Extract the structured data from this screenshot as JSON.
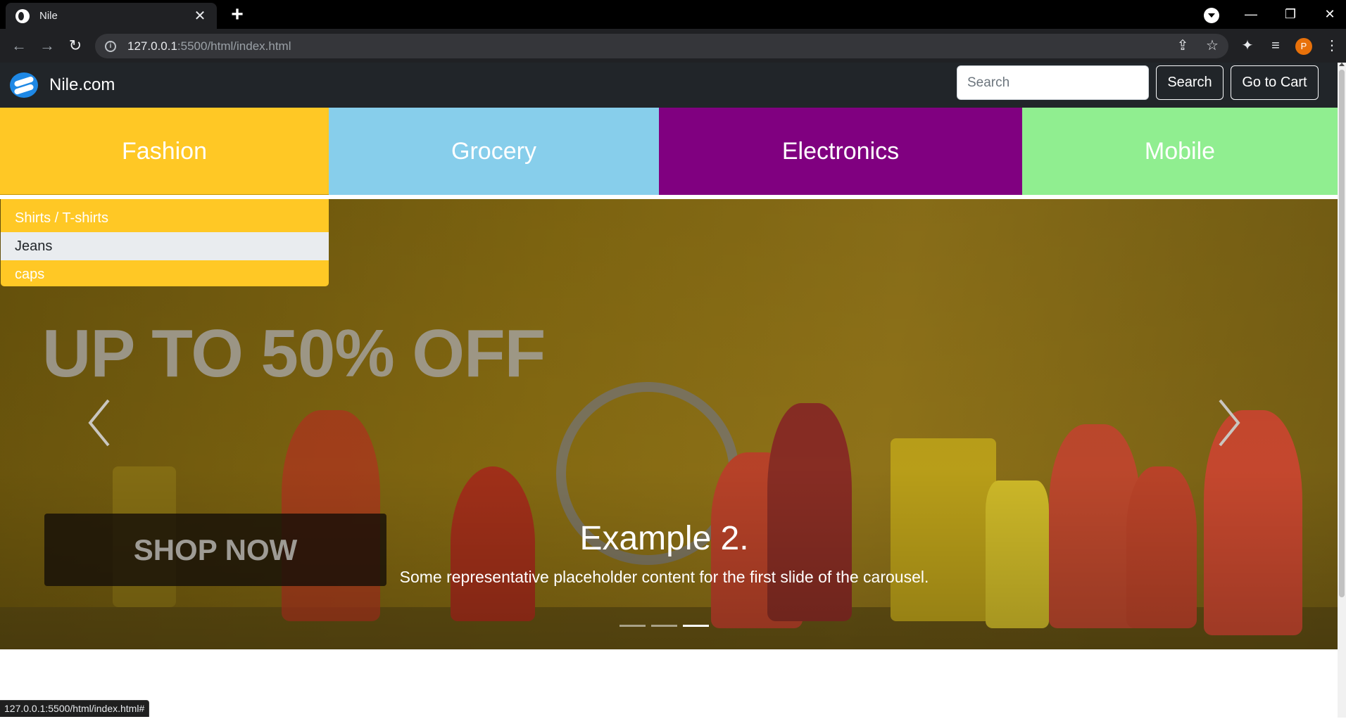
{
  "browser": {
    "tab": {
      "title": "Nile",
      "close_glyph": "✕"
    },
    "new_tab_glyph": "+",
    "url_host": "127.0.0.1",
    "url_path": ":5500/html/index.html",
    "profile_initial": "P",
    "status_url": "127.0.0.1:5500/html/index.html#",
    "controls": {
      "minimize": "—",
      "restore": "❐",
      "close": "✕"
    },
    "icons": {
      "back": "←",
      "forward": "→",
      "reload": "↻",
      "share": "⇪",
      "star": "☆",
      "extensions": "✦",
      "media": "≡",
      "menu": "⋮"
    }
  },
  "navbar": {
    "brand": "Nile.com",
    "search_placeholder": "Search",
    "search_button": "Search",
    "cart_button": "Go to Cart"
  },
  "categories": [
    {
      "label": "Fashion",
      "color": "#ffc825"
    },
    {
      "label": "Grocery",
      "color": "#87ceeb"
    },
    {
      "label": "Electronics",
      "color": "#800080"
    },
    {
      "label": "Mobile",
      "color": "#90ee90"
    }
  ],
  "fashion_dropdown": {
    "items": [
      "Shirts / T-shirts",
      "Jeans",
      "caps"
    ],
    "active_index": 1
  },
  "carousel": {
    "promo_text": "UP TO 50% OFF",
    "shop_text": "SHOP NOW",
    "caption_title": "Example 2.",
    "caption_text": "Some representative placeholder content for the first slide of the carousel.",
    "indicator_count": 3,
    "active_indicator": 2
  }
}
